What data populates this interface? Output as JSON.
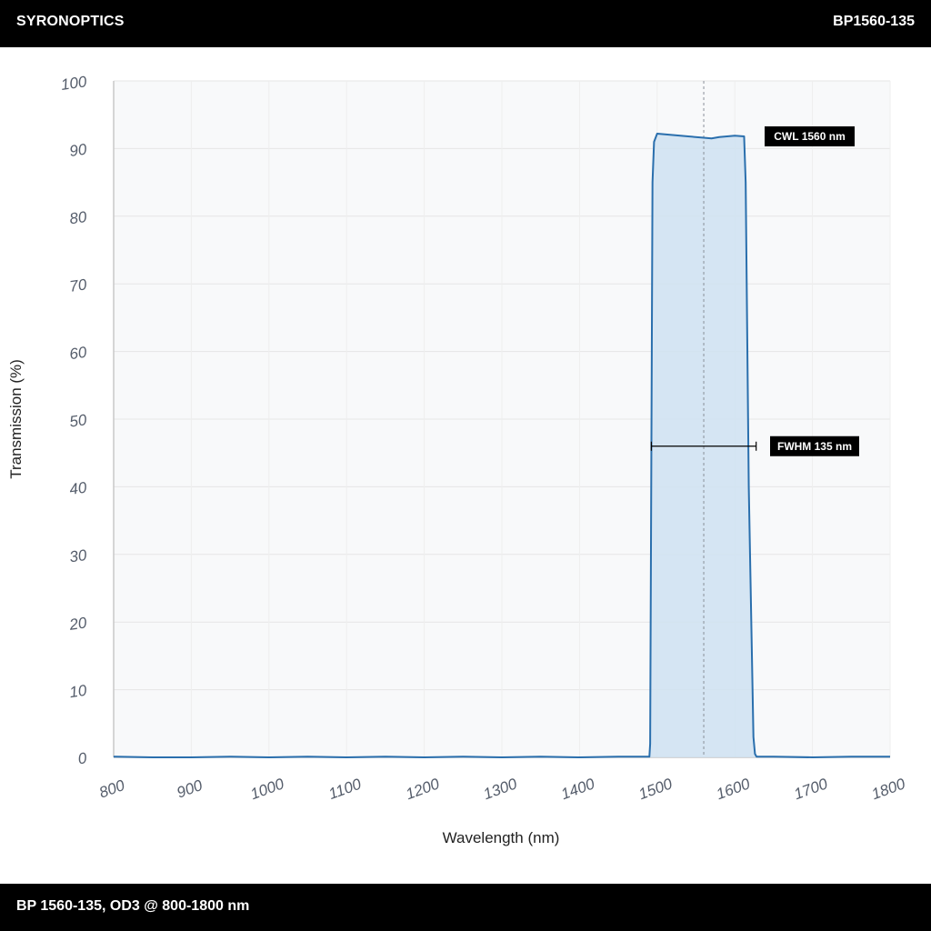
{
  "header": {
    "brand": "SYRONOPTICS",
    "part_number": "BP1560-135"
  },
  "footer": {
    "spec": "BP 1560-135, OD3 @ 800-1800 nm"
  },
  "colors": {
    "curve": "#2a6fad",
    "fill": "#cfe2f1",
    "bars": "#000000",
    "plot_bg": "#f8f9fa",
    "grid": "#e6e6e6"
  },
  "chart_data": {
    "type": "area",
    "xlabel": "Wavelength (nm)",
    "ylabel": "Transmission (%)",
    "xlim": [
      800,
      1800
    ],
    "ylim": [
      0,
      100
    ],
    "xticks": [
      800,
      900,
      1000,
      1100,
      1200,
      1300,
      1400,
      1500,
      1600,
      1700,
      1800
    ],
    "yticks": [
      0,
      10,
      20,
      30,
      40,
      50,
      60,
      70,
      80,
      90,
      100
    ],
    "grid": true,
    "series": [
      {
        "x": [
          800,
          850,
          900,
          950,
          1000,
          1050,
          1100,
          1150,
          1200,
          1250,
          1300,
          1350,
          1400,
          1450,
          1490,
          1491,
          1492,
          1494,
          1496,
          1500,
          1520,
          1540,
          1560,
          1570,
          1580,
          1600,
          1612,
          1614,
          1618,
          1624,
          1626,
          1628,
          1650,
          1700,
          1750,
          1800
        ],
        "y": [
          0.1,
          0.0,
          0.0,
          0.1,
          0.0,
          0.1,
          0.0,
          0.1,
          0.0,
          0.1,
          0.0,
          0.1,
          0.0,
          0.1,
          0.1,
          2.0,
          30.0,
          85.0,
          91.0,
          92.2,
          92.0,
          91.8,
          91.6,
          91.5,
          91.7,
          91.9,
          91.8,
          85.0,
          40.0,
          3.0,
          0.5,
          0.1,
          0.1,
          0.0,
          0.1,
          0.1
        ]
      }
    ],
    "annotations": [
      {
        "label": "CWL 1560 nm",
        "x": 1560,
        "type": "center-line"
      },
      {
        "label": "FWHM 135 nm",
        "x_start": 1492.5,
        "x_end": 1627.5,
        "y": 46,
        "type": "width-bar"
      }
    ]
  }
}
